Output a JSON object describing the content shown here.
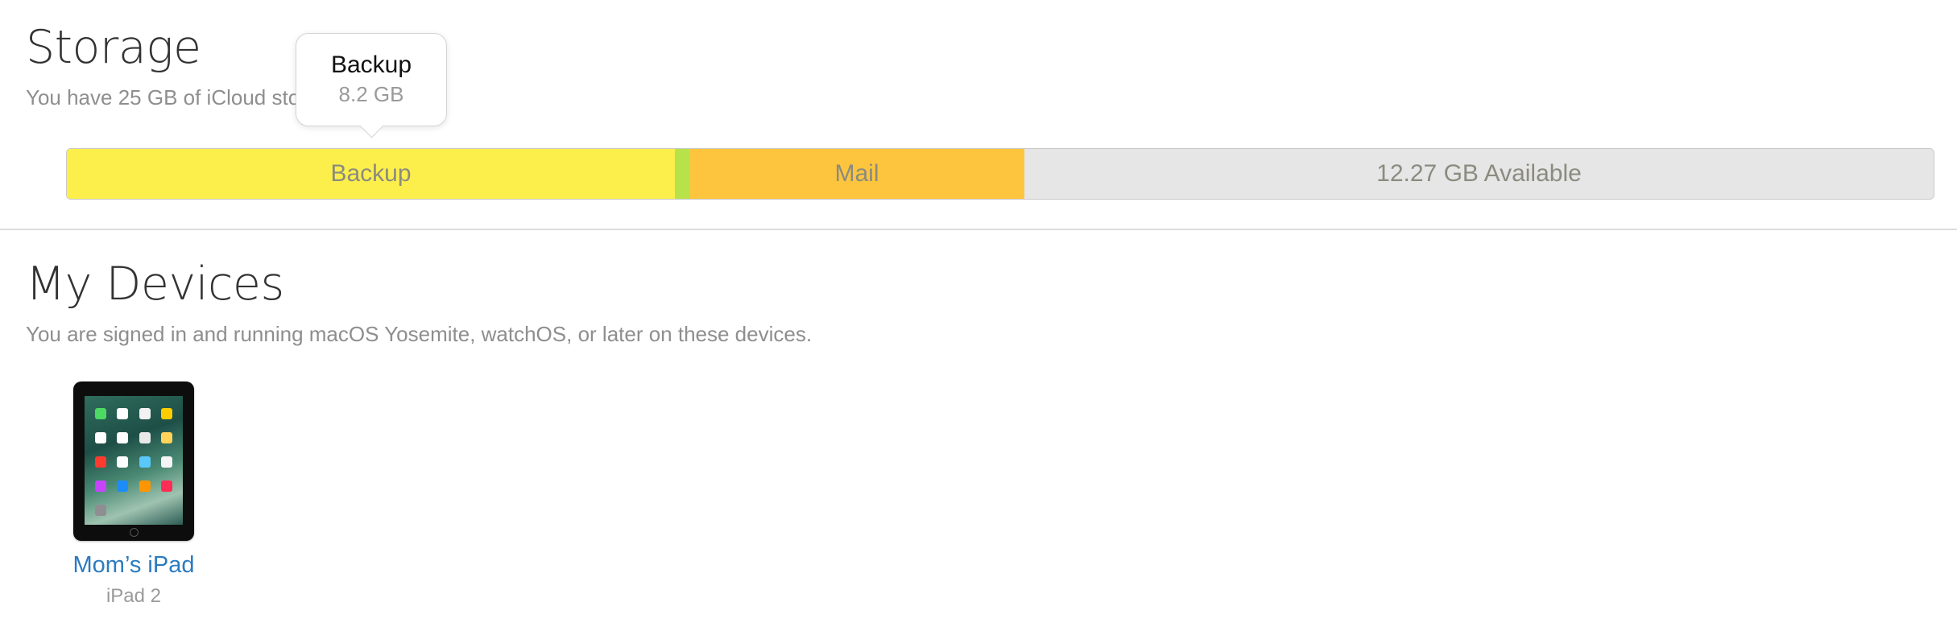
{
  "storage": {
    "title": "Storage",
    "subtitle": "You have 25 GB of iCloud storage.",
    "segments": [
      {
        "name": "Backup",
        "label": "Backup",
        "color": "#fcef4b",
        "size_gb": 8.2
      },
      {
        "name": "Other",
        "label": "",
        "color": "#b8e24a"
      },
      {
        "name": "Mail",
        "label": "Mail",
        "color": "#fdc53d"
      },
      {
        "name": "Available",
        "label": "12.27 GB Available",
        "color": "#e6e6e6"
      }
    ],
    "tooltip": {
      "label": "Backup",
      "size": "8.2 GB"
    }
  },
  "devices": {
    "title": "My Devices",
    "subtitle": "You are signed in and running macOS Yosemite, watchOS, or later on these devices.",
    "items": [
      {
        "name": "Mom’s iPad",
        "model": "iPad 2",
        "icon": "ipad-icon"
      }
    ]
  },
  "colors": {
    "link": "#2b7bc0",
    "muted_text": "#8e8e8e",
    "heading": "#333333"
  }
}
